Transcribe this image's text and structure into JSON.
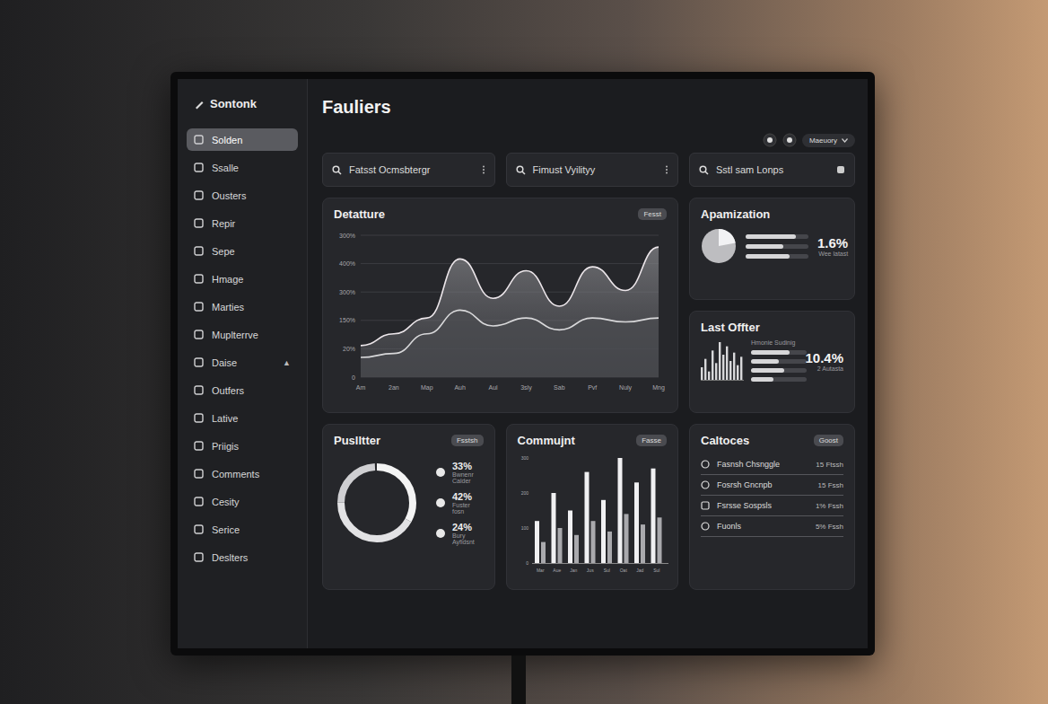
{
  "app": {
    "logo": "Sontonk",
    "title": "Fauliers"
  },
  "sidebar": {
    "items": [
      {
        "label": "Solden",
        "selected": true
      },
      {
        "label": "Ssalle",
        "selected": false
      },
      {
        "label": "Ousters",
        "selected": false
      },
      {
        "label": "Repir",
        "selected": false
      },
      {
        "label": "Sepe",
        "selected": false
      },
      {
        "label": "Hmage",
        "selected": false
      },
      {
        "label": "Marties",
        "selected": false
      },
      {
        "label": "Muplterrve",
        "selected": false
      },
      {
        "label": "Daise",
        "selected": false,
        "toggle": "▲"
      },
      {
        "label": "Outfers",
        "selected": false
      },
      {
        "label": "Lative",
        "selected": false
      },
      {
        "label": "Priigis",
        "selected": false
      },
      {
        "label": "Comments",
        "selected": false
      },
      {
        "label": "Cesity",
        "selected": false
      },
      {
        "label": "Serice",
        "selected": false
      },
      {
        "label": "Deslters",
        "selected": false
      }
    ]
  },
  "searches": [
    {
      "text": "Fatsst Ocmsbtergr"
    },
    {
      "text": "Fimust Vyilityy"
    },
    {
      "text": "Sstl sam Lonps"
    }
  ],
  "header": {
    "menu": "Maeuory"
  },
  "main_chart": {
    "title": "Detatture",
    "badge": "Fesst",
    "y_ticks": [
      "300%",
      "400%",
      "300%",
      "150%",
      "20%",
      "0"
    ],
    "x_labels": [
      "Am",
      "2an",
      "Map",
      "Auh",
      "Aul",
      "3sly",
      "Sab",
      "Pvf",
      "Nuly",
      "Mng"
    ],
    "series": [
      {
        "values": [
          80,
          110,
          150,
          300,
          200,
          270,
          180,
          280,
          220,
          330
        ]
      },
      {
        "values": [
          50,
          60,
          110,
          170,
          130,
          150,
          120,
          150,
          140,
          150
        ]
      }
    ]
  },
  "apamization": {
    "title": "Apamization",
    "value": "1.6%",
    "caption": "Wee latast",
    "pie_level": 0.22,
    "bars": [
      {
        "level": 0.8
      },
      {
        "level": 0.6
      },
      {
        "level": 0.7
      }
    ]
  },
  "last_offer": {
    "title": "Last Offter",
    "label": "Hmonie Sudinig",
    "value": "10.4%",
    "caption": "2 Autasta",
    "values": [
      30,
      50,
      20,
      70,
      40,
      90,
      60,
      80,
      45,
      65,
      35,
      55
    ],
    "bars": [
      {
        "level": 0.7
      },
      {
        "level": 0.5
      },
      {
        "level": 0.6
      },
      {
        "level": 0.4
      }
    ]
  },
  "publisher": {
    "title": "Puslltter",
    "badge": "Fsstsh",
    "segments": [
      {
        "value": "33%",
        "label": "Bwnenr Calder",
        "share": 0.33
      },
      {
        "value": "42%",
        "label": "Fuster fosn",
        "share": 0.42
      },
      {
        "value": "24%",
        "label": "Bury Ayfidsnt",
        "share": 0.24
      }
    ]
  },
  "community": {
    "title": "Commujnt",
    "badge": "Fasse",
    "y_ticks": [
      "300",
      "200",
      "100",
      "0"
    ],
    "x_labels": [
      "Mar",
      "Aue",
      "Jan",
      "Jus",
      "Sul",
      "Oat",
      "Jad",
      "Sul"
    ],
    "series": [
      {
        "values": [
          120,
          200,
          150,
          260,
          180,
          300,
          230,
          270
        ]
      },
      {
        "values": [
          60,
          100,
          80,
          120,
          90,
          140,
          110,
          130
        ]
      }
    ]
  },
  "calories": {
    "title": "Caltoces",
    "badge": "Goost",
    "rows": [
      {
        "label": "Fasnsh Chsnggle",
        "value": "15 Ftssh"
      },
      {
        "label": "Fosrsh Gncnpb",
        "value": "15 Fssh"
      },
      {
        "label": "Fsrsse Sospsls",
        "value": "1% Fssh"
      },
      {
        "label": "Fuonls",
        "value": "5% Fssh"
      }
    ]
  }
}
